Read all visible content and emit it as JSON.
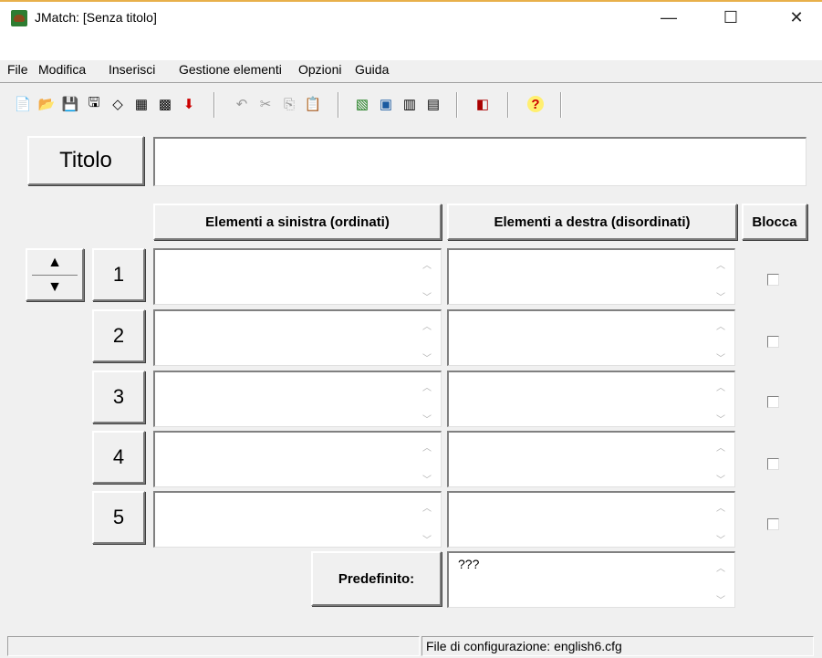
{
  "window": {
    "title": "JMatch: [Senza titolo]",
    "controls": {
      "minimize": "—",
      "maximize": "☐",
      "close": "✕"
    }
  },
  "menu": [
    "File",
    "Modifica",
    "Inserisci",
    "Gestione elementi",
    "Opzioni",
    "Guida"
  ],
  "toolbar": {
    "icons": [
      "new-file-icon",
      "open-folder-icon",
      "save-icon",
      "save-as-icon",
      "eraser-icon",
      "web-page-icon",
      "web-page-alt-icon",
      "export-arrow-icon",
      "undo-icon",
      "cut-icon",
      "copy-icon",
      "paste-icon",
      "web-export-icon",
      "window-export-icon",
      "graph-icon",
      "graph-alt-icon",
      "color-palette-icon",
      "help-icon"
    ]
  },
  "form": {
    "title_button": "Titolo",
    "title_value": "",
    "headers": {
      "left": "Elementi a sinistra (ordinati)",
      "right": "Elementi a destra (disordinati)",
      "lock": "Blocca"
    },
    "rows": [
      {
        "num": "1",
        "left": "",
        "right": "",
        "locked": false
      },
      {
        "num": "2",
        "left": "",
        "right": "",
        "locked": false
      },
      {
        "num": "3",
        "left": "",
        "right": "",
        "locked": false
      },
      {
        "num": "4",
        "left": "",
        "right": "",
        "locked": false
      },
      {
        "num": "5",
        "left": "",
        "right": "",
        "locked": false
      }
    ],
    "default_label": "Predefinito:",
    "default_value": "???"
  },
  "status": {
    "left": "",
    "config": "File di configurazione: english6.cfg"
  }
}
